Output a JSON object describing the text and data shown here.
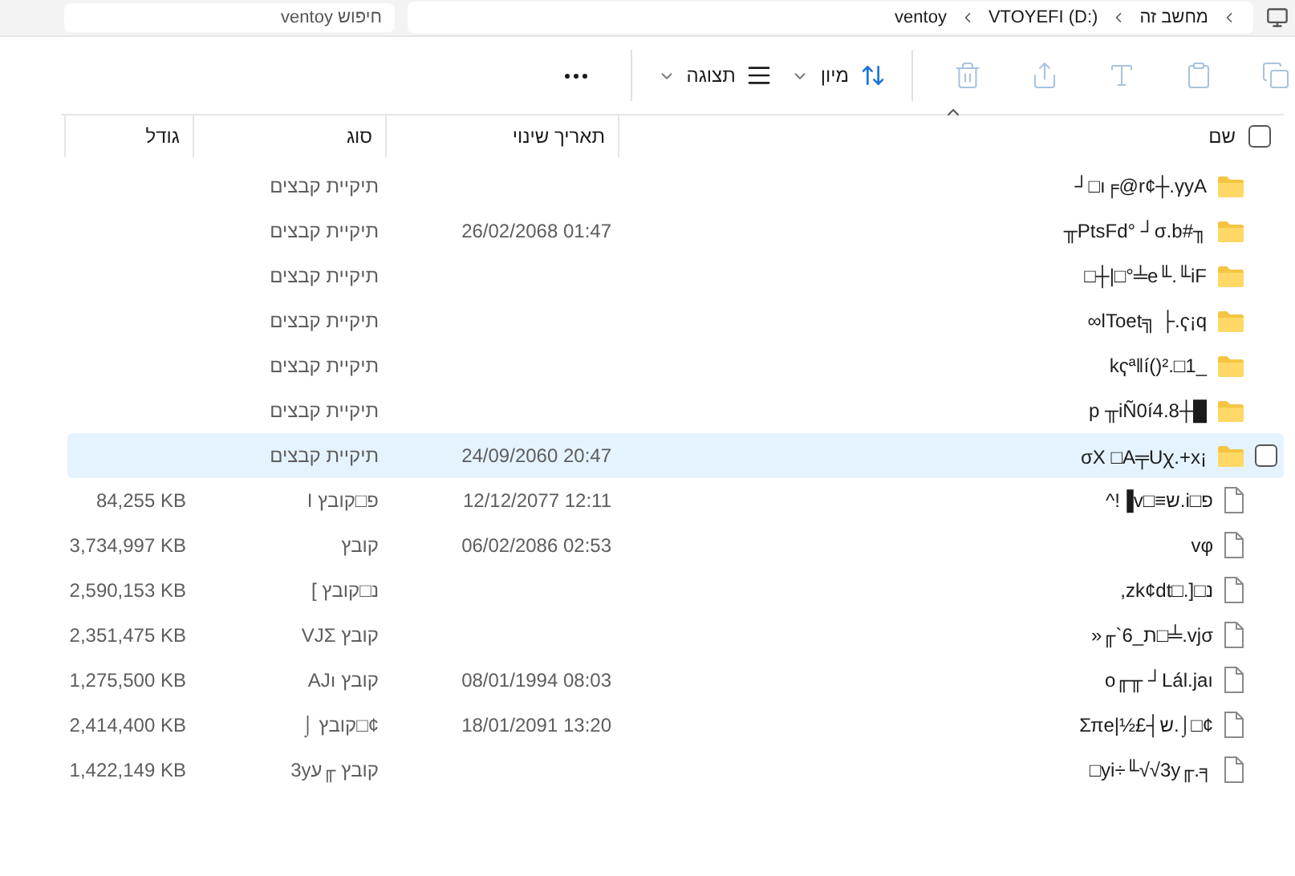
{
  "address_bar": {
    "breadcrumbs": [
      "מחשב זה",
      "VTOYEFI (D:)",
      "ventoy"
    ],
    "search": {
      "placeholder": "חיפוש ventoy"
    }
  },
  "toolbar": {
    "actions": [
      {
        "kind": "copy",
        "disabled": true
      },
      {
        "kind": "paste",
        "disabled": true
      },
      {
        "kind": "rename",
        "disabled": true
      },
      {
        "kind": "share",
        "disabled": true
      },
      {
        "kind": "delete",
        "disabled": true
      }
    ],
    "sort": {
      "label": "מיון"
    },
    "view": {
      "label": "תצוגה"
    }
  },
  "table": {
    "select_all": {
      "checked": false
    },
    "columns": [
      "שם",
      "תאריך שינוי",
      "סוג",
      "גודל"
    ],
    "rows": [
      {
        "kind": "folder",
        "name": "┘□ı╒@r¢┼.γyA",
        "date": "",
        "type": "תיקיית קבצים",
        "size": "",
        "selected": false
      },
      {
        "kind": "folder",
        "name": "╥PtsFd° ┘σ.b#╖",
        "date": "26/02/2068 01:47",
        "type": "תיקיית קבצים",
        "size": "",
        "selected": false
      },
      {
        "kind": "folder",
        "name": "□┼|□°╧e╙.╙iF",
        "date": "",
        "type": "תיקיית קבצים",
        "size": "",
        "selected": false
      },
      {
        "kind": "folder",
        "name": "∞lToet╗ ├.ҁ¡q",
        "date": "",
        "type": "תיקיית קבצים",
        "size": "",
        "selected": false
      },
      {
        "kind": "folder",
        "name": "kҁª‖í()².□1_",
        "date": "",
        "type": "תיקיית קבצים",
        "size": "",
        "selected": false
      },
      {
        "kind": "folder",
        "name": "p ╥iÑ0í4.8┼█",
        "date": "",
        "type": "תיקיית קבצים",
        "size": "",
        "selected": false
      },
      {
        "kind": "folder",
        "name": "σX □A╤Uꭓ.+x¡",
        "date": "24/09/2060 20:47",
        "type": "תיקיית קבצים",
        "size": "",
        "selected": true
      },
      {
        "kind": "file",
        "name": "^!▐v□≡ש.i□פ",
        "date": "12/12/2077 12:11",
        "type": "פ□קובץ I",
        "size": "84,255 KB",
        "selected": false
      },
      {
        "kind": "file",
        "name": "vφ",
        "date": "06/02/2086 02:53",
        "type": "קובץ",
        "size": "3,734,997 KB",
        "selected": false
      },
      {
        "kind": "file",
        "name": ",zk¢dt□.]□נ",
        "date": "",
        "type": "נ□קובץ ]",
        "size": "2,590,153 KB",
        "selected": false
      },
      {
        "kind": "file",
        "name": "»╓`6_ת□╧.vjσ",
        "date": "",
        "type": "קובץ VJΣ",
        "size": "2,351,475 KB",
        "selected": false
      },
      {
        "kind": "file",
        "name": "o╓╥ ┘Lál.jaı",
        "date": "08/01/1994 08:03",
        "type": "קובץ AJı",
        "size": "1,275,500 KB",
        "selected": false
      },
      {
        "kind": "file",
        "name": "Σπe|½£┤ש.⌡□¢",
        "date": "18/01/2091 13:20",
        "type": "¢□קובץ ⌡",
        "size": "2,414,400 KB",
        "selected": false
      },
      {
        "kind": "file",
        "name": "□yi÷╙√√3y╓.╕",
        "date": "",
        "type": "קובץ ╓ע3y",
        "size": "1,422,149 KB",
        "selected": false
      }
    ]
  }
}
